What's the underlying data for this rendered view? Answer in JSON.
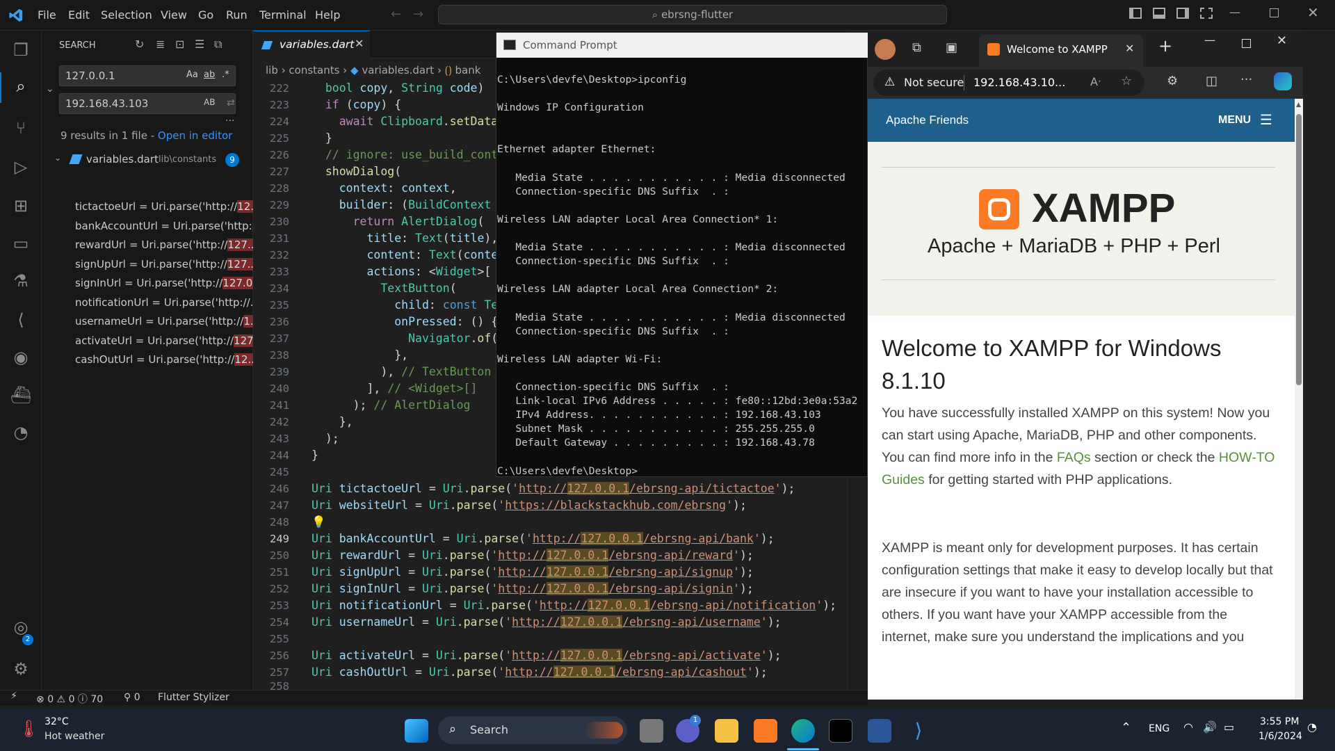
{
  "titlebar": {
    "menus": [
      "File",
      "Edit",
      "Selection",
      "View",
      "Go",
      "Run",
      "Terminal",
      "Help"
    ],
    "search": "ebrsng-flutter"
  },
  "sidebar": {
    "title": "SEARCH",
    "search_value": "127.0.0.1",
    "replace_value": "192.168.43.103",
    "opt_case": "Aa",
    "opt_word": "ab",
    "opt_regex": ".*",
    "opt_preserve": "AB",
    "summary": "9 results in 1 file - ",
    "open_editor": "Open in editor",
    "file_name": "variables.dart",
    "file_path": "lib\\constants",
    "file_count": "9",
    "results": [
      {
        "pre": "tictactoeUrl = Uri.parse('http://",
        "hl": "12..."
      },
      {
        "pre": "bankAccountUrl = Uri.parse('http:...",
        "hl": ""
      },
      {
        "pre": "rewardUrl = Uri.parse('http://",
        "hl": "127...."
      },
      {
        "pre": "signUpUrl = Uri.parse('http://",
        "hl": "127...."
      },
      {
        "pre": "signInUrl = Uri.parse('http://",
        "hl": "127.0..."
      },
      {
        "pre": "notificationUrl = Uri.parse('http://...",
        "hl": ""
      },
      {
        "pre": "usernameUrl = Uri.parse('http://",
        "hl": "1..."
      },
      {
        "pre": "activateUrl = Uri.parse('http://",
        "hl": "127...."
      },
      {
        "pre": "cashOutUrl = Uri.parse('http://",
        "hl": "12..."
      }
    ]
  },
  "editor": {
    "tab": "variables.dart",
    "breadcrumb": [
      "lib",
      "constants",
      "variables.dart",
      "bank"
    ],
    "lines": [
      "222",
      "223",
      "224",
      "225",
      "226",
      "227",
      "228",
      "229",
      "230",
      "231",
      "232",
      "233",
      "234",
      "235",
      "236",
      "237",
      "238",
      "239",
      "240",
      "241",
      "242",
      "243",
      "244",
      "245",
      "246",
      "247",
      "248",
      "249",
      "250",
      "251",
      "252",
      "253",
      "254",
      "255",
      "256",
      "257",
      "258"
    ]
  },
  "cmd": {
    "title": "Command Prompt",
    "output": "C:\\Users\\devfe\\Desktop>ipconfig\n\nWindows IP Configuration\n\n\nEthernet adapter Ethernet:\n\n   Media State . . . . . . . . . . . : Media disconnected\n   Connection-specific DNS Suffix  . :\n\nWireless LAN adapter Local Area Connection* 1:\n\n   Media State . . . . . . . . . . . : Media disconnected\n   Connection-specific DNS Suffix  . :\n\nWireless LAN adapter Local Area Connection* 2:\n\n   Media State . . . . . . . . . . . : Media disconnected\n   Connection-specific DNS Suffix  . :\n\nWireless LAN adapter Wi-Fi:\n\n   Connection-specific DNS Suffix  . :\n   Link-local IPv6 Address . . . . . : fe80::12bd:3e0a:53a2\n   IPv4 Address. . . . . . . . . . . : 192.168.43.103\n   Subnet Mask . . . . . . . . . . . : 255.255.255.0\n   Default Gateway . . . . . . . . . : 192.168.43.78\n\nC:\\Users\\devfe\\Desktop>"
  },
  "browser": {
    "tab_title": "Welcome to XAMPP",
    "not_secure": "Not secure",
    "url": "192.168.43.10...",
    "brand": "Apache Friends",
    "menu": "MENU",
    "logo_text": "XAMPP",
    "tagline": "Apache + MariaDB + PHP + Perl",
    "heading": "Welcome to XAMPP for Windows 8.1.10",
    "p1_a": "You have successfully installed XAMPP on this system! Now you can start using Apache, MariaDB, PHP and other components. You can find more info in the ",
    "faqs": "FAQs",
    "p1_b": " section or check the ",
    "howto": "HOW-TO Guides",
    "p1_c": " for getting started with PHP applications.",
    "p2": "XAMPP is meant only for development purposes. It has certain configuration settings that make it easy to develop locally but that are insecure if you want to have your installation accessible to others. If you want have your XAMPP accessible from the internet, make sure you understand the implications and you"
  },
  "status": {
    "errors": "0",
    "warnings": "0",
    "info": "70",
    "ports": "0",
    "ext": "Flutter Stylizer"
  },
  "taskbar": {
    "temp": "32°C",
    "weather": "Hot weather",
    "search": "Search",
    "lang": "ENG",
    "time": "3:55 PM",
    "date": "1/6/2024",
    "accounts_badge": "2",
    "teams_badge": "1"
  },
  "colors": {
    "accent": "#0078d4",
    "xampp": "#fb7a24",
    "link": "#5a8f3c"
  }
}
